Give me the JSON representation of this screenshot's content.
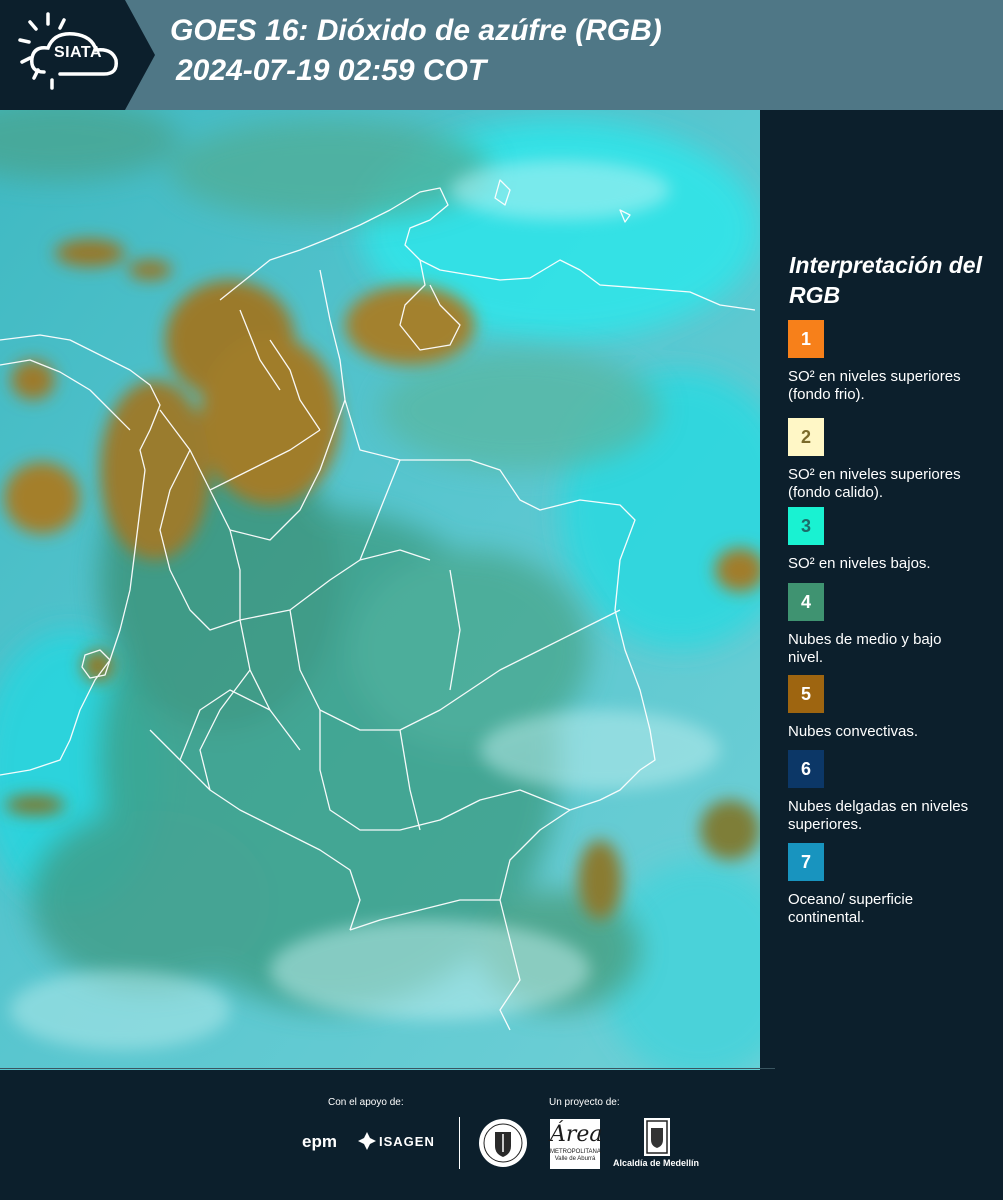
{
  "header": {
    "logo_text": "SIATA",
    "title_line1": "GOES 16: Dióxido de azúfre (RGB)",
    "title_line2": "2024-07-19 02:59 COT"
  },
  "legend": {
    "title": "Interpretación del RGB",
    "items": [
      {
        "number": "1",
        "color": "#f7801a",
        "num_color": "#ffffff",
        "label": "SO² en niveles superiores (fondo frio)."
      },
      {
        "number": "2",
        "color": "#fff7c6",
        "num_color": "#7a6a2a",
        "label": "SO² en niveles superiores (fondo calido)."
      },
      {
        "number": "3",
        "color": "#19f2d2",
        "num_color": "#1c6c6a",
        "label": "SO² en niveles bajos."
      },
      {
        "number": "4",
        "color": "#3f9371",
        "num_color": "#ffffff",
        "label": "Nubes de medio y bajo nivel."
      },
      {
        "number": "5",
        "color": "#9e6510",
        "num_color": "#ffffff",
        "label": "Nubes convectivas."
      },
      {
        "number": "6",
        "color": "#0c3767",
        "num_color": "#ffffff",
        "label": "Nubes delgadas en niveles superiores."
      },
      {
        "number": "7",
        "color": "#1894bf",
        "num_color": "#ffffff",
        "label": "Oceano/ superficie continental."
      }
    ]
  },
  "footer": {
    "support_label": "Con el apoyo de:",
    "project_label": "Un proyecto de:",
    "sponsor_epm": "epm",
    "sponsor_isagen": "ISAGEN",
    "amva_mark": "Área",
    "amva_sub": "METROPOLITANA Valle de Aburrá",
    "alcaldia": "Alcaldía de Medellín"
  }
}
